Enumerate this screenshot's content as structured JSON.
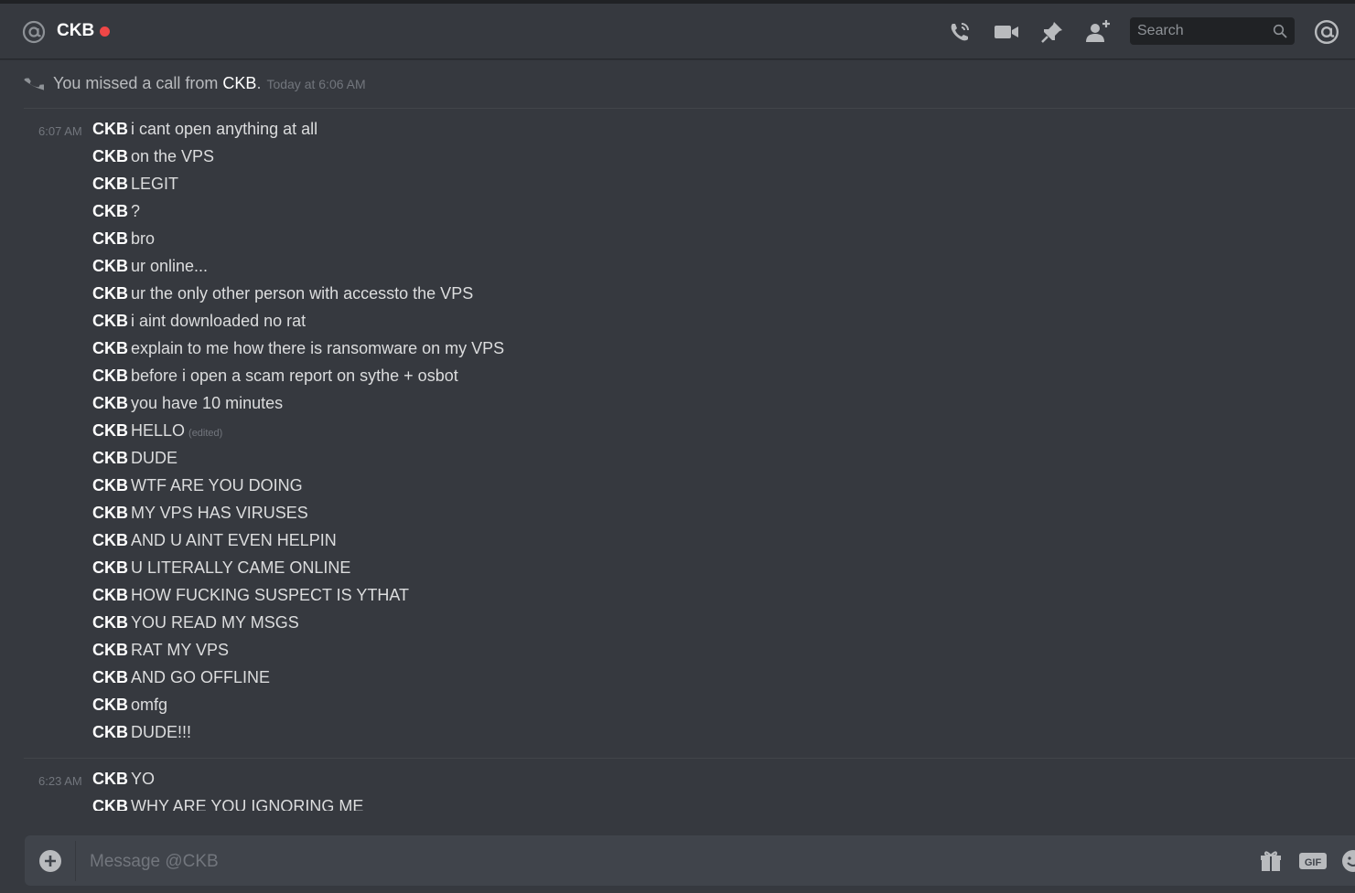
{
  "header": {
    "channel_name": "CKB",
    "status": "dnd",
    "status_color": "#f04747",
    "icons": [
      "at-icon",
      "call-icon",
      "video-icon",
      "pin-icon",
      "add-friend-icon",
      "mention-icon"
    ],
    "search_placeholder": "Search"
  },
  "system_message": {
    "prefix": "You missed a call from ",
    "caller": "CKB",
    "suffix": ".",
    "time": "Today at 6:06 AM"
  },
  "groups": [
    {
      "timestamp": "6:07 AM",
      "messages": [
        {
          "author": "CKB",
          "text": "i cant open anything at all"
        },
        {
          "author": "CKB",
          "text": "on the VPS"
        },
        {
          "author": "CKB",
          "text": "LEGIT"
        },
        {
          "author": "CKB",
          "text": "?"
        },
        {
          "author": "CKB",
          "text": "bro"
        },
        {
          "author": "CKB",
          "text": "ur online..."
        },
        {
          "author": "CKB",
          "text": "ur the only other person with accessto the VPS"
        },
        {
          "author": "CKB",
          "text": "i aint downloaded no rat"
        },
        {
          "author": "CKB",
          "text": "explain to me how there is ransomware on my VPS"
        },
        {
          "author": "CKB",
          "text": "before i open a scam report on sythe + osbot"
        },
        {
          "author": "CKB",
          "text": "you have 10 minutes"
        },
        {
          "author": "CKB",
          "text": "HELLO",
          "edited": "(edited)"
        },
        {
          "author": "CKB",
          "text": "DUDE"
        },
        {
          "author": "CKB",
          "text": "WTF ARE YOU DOING"
        },
        {
          "author": "CKB",
          "text": "MY VPS HAS VIRUSES"
        },
        {
          "author": "CKB",
          "text": "AND U AINT EVEN HELPIN"
        },
        {
          "author": "CKB",
          "text": "U LITERALLY CAME ONLINE"
        },
        {
          "author": "CKB",
          "text": "HOW FUCKING SUSPECT IS YTHAT"
        },
        {
          "author": "CKB",
          "text": "YOU READ MY MSGS"
        },
        {
          "author": "CKB",
          "text": "RAT MY VPS"
        },
        {
          "author": "CKB",
          "text": "AND GO OFFLINE"
        },
        {
          "author": "CKB",
          "text": "omfg"
        },
        {
          "author": "CKB",
          "text": "DUDE!!!"
        }
      ]
    },
    {
      "timestamp": "6:23 AM",
      "messages": [
        {
          "author": "CKB",
          "text": "YO"
        },
        {
          "author": "CKB",
          "text": "WHY ARE YOU IGNORING ME"
        }
      ]
    }
  ],
  "composer": {
    "placeholder": "Message @CKB",
    "icons": [
      "add-attachment-icon",
      "gift-icon",
      "gif-icon",
      "emoji-icon"
    ],
    "gif_label": "GIF"
  }
}
